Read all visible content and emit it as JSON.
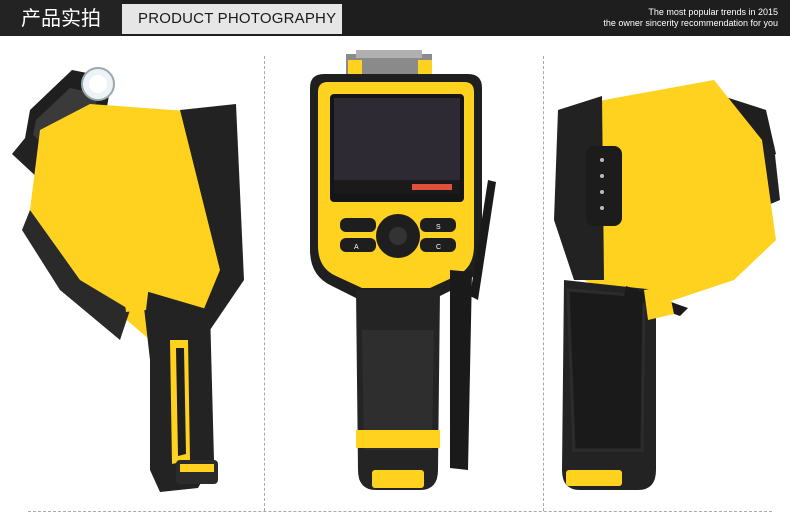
{
  "header": {
    "title_cn": "产品实拍",
    "title_en": "PRODUCT PHOTOGRAPHY",
    "tagline_line1": "The most popular trends in 2015",
    "tagline_line2": "the owner sincerity recommendation for you"
  },
  "product": {
    "buttons": {
      "a": "A",
      "s": "S",
      "c": "C"
    }
  },
  "colors": {
    "accent_yellow": "#ffd21f",
    "body_black": "#252525",
    "header_dark": "#1e1e1e"
  }
}
